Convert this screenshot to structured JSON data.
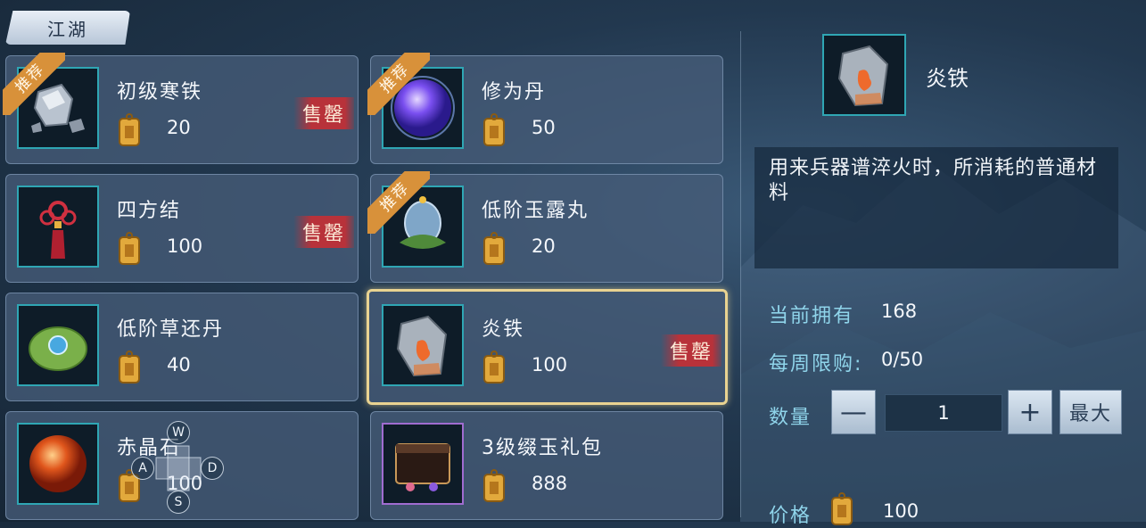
{
  "tab": {
    "label": "江湖"
  },
  "items": [
    {
      "name": "初级寒铁",
      "price": "20",
      "badge": "售罄",
      "recommend": "推荐"
    },
    {
      "name": "修为丹",
      "price": "50",
      "badge": "",
      "recommend": "推荐"
    },
    {
      "name": "四方结",
      "price": "100",
      "badge": "售罄",
      "recommend": ""
    },
    {
      "name": "低阶玉露丸",
      "price": "20",
      "badge": "",
      "recommend": "推荐"
    },
    {
      "name": "低阶草还丹",
      "price": "40",
      "badge": "",
      "recommend": ""
    },
    {
      "name": "炎铁",
      "price": "100",
      "badge": "售罄",
      "recommend": ""
    },
    {
      "name": "赤晶石",
      "price": "100",
      "badge": "",
      "recommend": ""
    },
    {
      "name": "3级缀玉礼包",
      "price": "888",
      "badge": "",
      "recommend": ""
    }
  ],
  "detail": {
    "name": "炎铁",
    "description": "用来兵器谱淬火时，所消耗的普通材料",
    "owned_label": "当前拥有",
    "owned_value": "168",
    "weekly_label": "每周限购:",
    "weekly_value": "0/50",
    "qty_label": "数量",
    "qty_minus": "—",
    "qty_value": "1",
    "qty_plus": "+",
    "max_label": "最大",
    "price_label": "价格",
    "price_value": "100"
  },
  "wasd": {
    "up": "W",
    "left": "A",
    "right": "D",
    "down": "S"
  },
  "colors": {
    "accent": "#2fa6b4",
    "sold_badge": "#b8323a",
    "recommend": "#d8913a",
    "selected_border": "#e9d391",
    "label": "#8fd4ea"
  }
}
